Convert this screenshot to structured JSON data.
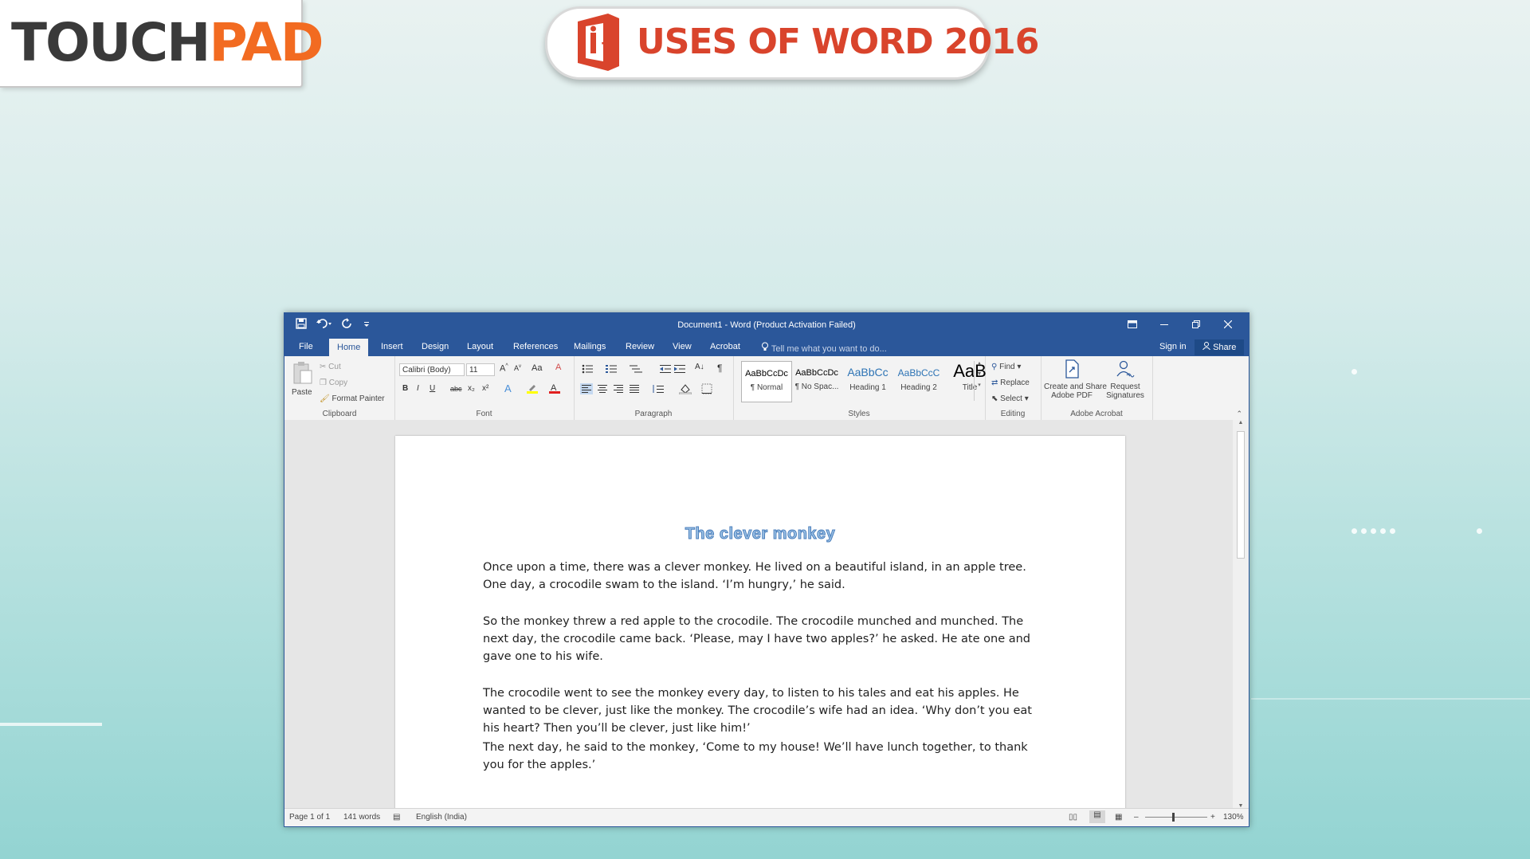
{
  "brand": {
    "logo_part1": "TOUCH",
    "logo_part2": "PAD",
    "logo_color_dark": "#3a3a3a",
    "logo_color_accent": "#f26b21"
  },
  "banner": {
    "title": "USES OF WORD 2016",
    "icon": "office-logo-icon",
    "color": "#d9442c"
  },
  "window": {
    "title": "Document1 - Word (Product Activation Failed)",
    "controls": {
      "ribbon_display": "ribbon-display-icon",
      "minimize": "minimize-icon",
      "restore": "restore-icon",
      "close": "close-icon"
    }
  },
  "qat": {
    "save": "save-icon",
    "undo": "undo-icon",
    "redo": "redo-icon",
    "customize": "customize-icon"
  },
  "tabs": [
    {
      "label": "File"
    },
    {
      "label": "Home"
    },
    {
      "label": "Insert"
    },
    {
      "label": "Design"
    },
    {
      "label": "Layout"
    },
    {
      "label": "References"
    },
    {
      "label": "Mailings"
    },
    {
      "label": "Review"
    },
    {
      "label": "View"
    },
    {
      "label": "Acrobat"
    }
  ],
  "active_tab": "Home",
  "tellme": "Tell me what you want to do...",
  "signin": "Sign in",
  "share": "Share",
  "ribbon": {
    "clipboard": {
      "label": "Clipboard",
      "paste": "Paste",
      "cut": "Cut",
      "copy": "Copy",
      "format_painter": "Format Painter"
    },
    "font": {
      "label": "Font",
      "font_name": "Calibri (Body)",
      "font_size": "11",
      "change_case": "Aa",
      "bold": "B",
      "italic": "I",
      "underline": "U",
      "strike": "abc",
      "subscript": "x₂",
      "superscript": "x²"
    },
    "paragraph": {
      "label": "Paragraph",
      "pilcrow": "¶"
    },
    "styles": {
      "label": "Styles",
      "items": [
        {
          "preview": "AaBbCcDc",
          "name": "¶ Normal"
        },
        {
          "preview": "AaBbCcDc",
          "name": "¶ No Spac..."
        },
        {
          "preview": "AaBbCc",
          "name": "Heading 1"
        },
        {
          "preview": "AaBbCcC",
          "name": "Heading 2"
        },
        {
          "preview": "AaB",
          "name": "Title"
        }
      ]
    },
    "editing": {
      "label": "Editing",
      "find": "Find",
      "replace": "Replace",
      "select": "Select"
    },
    "acrobat": {
      "label": "Adobe Acrobat",
      "create_line1": "Create and Share",
      "create_line2": "Adobe PDF",
      "request_line1": "Request",
      "request_line2": "Signatures"
    }
  },
  "document": {
    "heading": "The clever monkey",
    "paragraphs": [
      "Once upon a time, there was a clever monkey. He lived on a beautiful island, in an apple tree. One day, a crocodile swam to the island. ‘I’m hungry,’ he said.",
      "So the monkey threw a red apple to the crocodile. The crocodile munched and munched. The next day, the crocodile came back. ‘Please, may I have two apples?’ he asked. He ate one and gave one to his wife.",
      "The crocodile went to see the monkey every day, to listen to his tales and eat his apples. He wanted to be clever, just like the monkey. The crocodile’s wife had an idea. ‘Why don’t you eat his heart? Then you’ll be clever, just like him!’",
      "The next day, he said to the monkey, ‘Come to my house! We’ll have lunch together, to thank you for the apples.’"
    ]
  },
  "status": {
    "page": "Page 1 of 1",
    "words": "141 words",
    "language": "English (India)",
    "zoom": "130%"
  }
}
